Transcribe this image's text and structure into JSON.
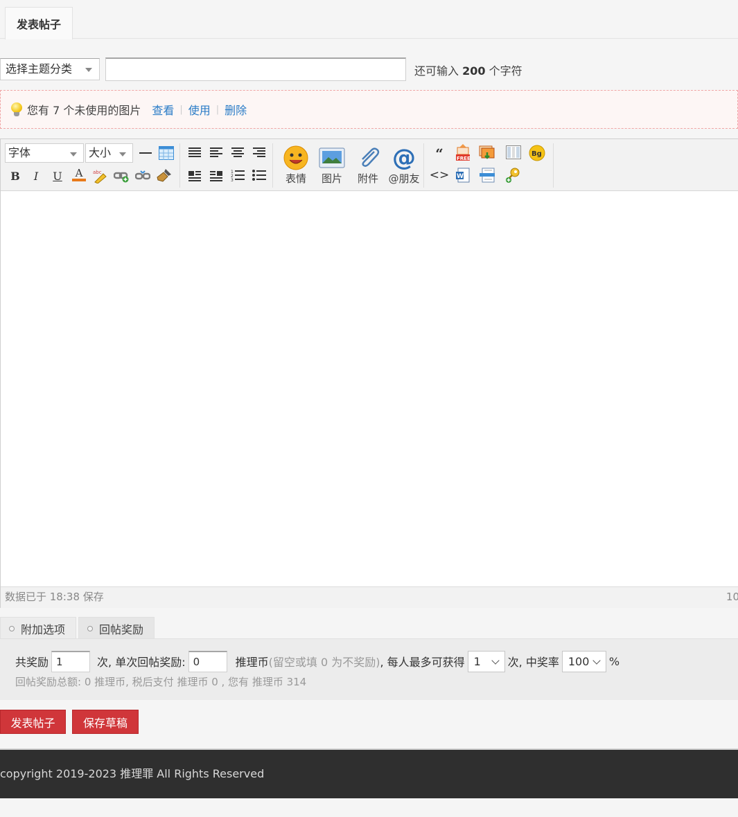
{
  "tabs": {
    "post": "发表帖子"
  },
  "subject": {
    "category_placeholder": "选择主题分类",
    "title_value": "",
    "remaining_prefix": "还可输入",
    "remaining_count": "200",
    "remaining_suffix": "个字符"
  },
  "notice": {
    "message": "您有 7 个未使用的图片",
    "view": "查看",
    "use": "使用",
    "delete": "删除"
  },
  "toolbar": {
    "font": "字体",
    "size": "大小",
    "bold": "B",
    "italic": "I",
    "underline": "U",
    "font_color": "A",
    "emoji": "表情",
    "image": "图片",
    "attach": "附件",
    "at_friend": "@朋友",
    "quote": "“",
    "code": "<>"
  },
  "editor": {
    "saved_status": "数据已于 18:38 保存",
    "char_count": "10"
  },
  "options": {
    "tab_extra": "附加选项",
    "tab_reward": "回帖奖励",
    "total_label": "共奖励",
    "total_value": "1",
    "per_label": "次, 单次回帖奖励:",
    "per_value": "0",
    "currency": "推理币",
    "hint": "(留空或填 0 为不奖励)",
    "max_label": ", 每人最多可获得",
    "max_value": "1",
    "rate_label": "次, 中奖率",
    "rate_value": "100",
    "percent": "%",
    "summary": "回帖奖励总额: 0 推理币, 税后支付 推理币 0 , 您有 推理币 314"
  },
  "actions": {
    "submit": "发表帖子",
    "save_draft": "保存草稿"
  },
  "footer": {
    "copyright": "copyright 2019-2023 推理罪 All Rights Reserved"
  },
  "colors": {
    "accent_red": "#d0363a",
    "link_blue": "#2a7cc7",
    "footer_bg": "#2f2f2f"
  }
}
